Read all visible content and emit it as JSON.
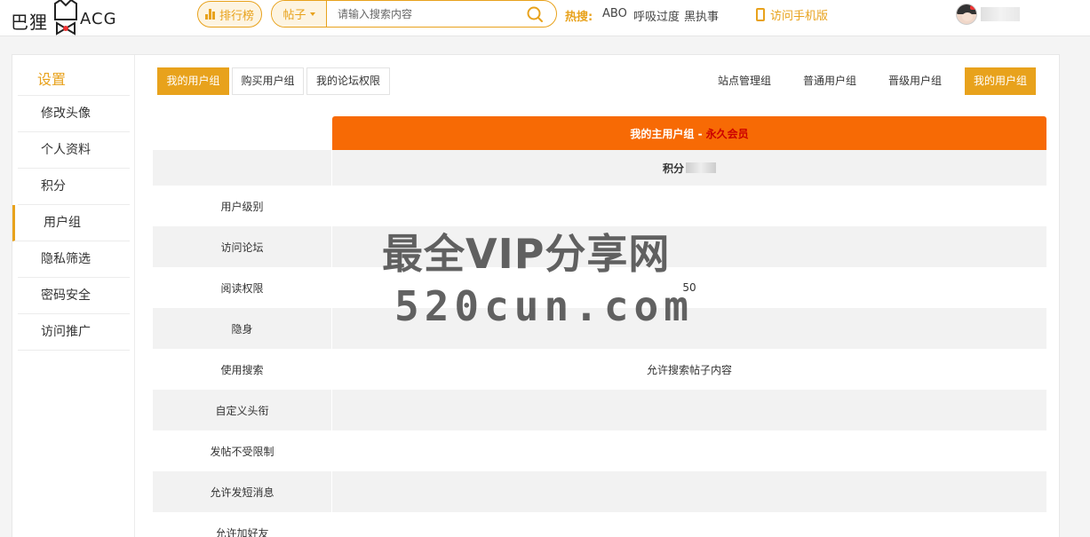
{
  "header": {
    "logo_left": "巴狸",
    "logo_right": "ACG",
    "rank_label": "排行榜",
    "search_type": "帖子",
    "search_placeholder": "请输入搜索内容",
    "hot_label": "热搜:",
    "hot_items": [
      "ABO",
      "呼吸过度",
      "黑执事"
    ],
    "mobile_label": "访问手机版"
  },
  "sidebar": {
    "title": "设置",
    "items": [
      {
        "label": "修改头像"
      },
      {
        "label": "个人资料"
      },
      {
        "label": "积分"
      },
      {
        "label": "用户组",
        "active": true
      },
      {
        "label": "隐私筛选"
      },
      {
        "label": "密码安全"
      },
      {
        "label": "访问推广"
      }
    ]
  },
  "tabs": {
    "left": [
      "我的用户组",
      "购买用户组",
      "我的论坛权限"
    ],
    "right": [
      "站点管理组",
      "普通用户组",
      "晋级用户组",
      "我的用户组"
    ]
  },
  "usergroup": {
    "header_prefix": "我的主用户组 - ",
    "group_name": "永久会员",
    "score_label": "积分"
  },
  "rows": [
    {
      "label": "用户级别",
      "value": ""
    },
    {
      "label": "访问论坛",
      "value": ""
    },
    {
      "label": "阅读权限",
      "value": "50"
    },
    {
      "label": "隐身",
      "value": ""
    },
    {
      "label": "使用搜索",
      "value": "允许搜索帖子内容"
    },
    {
      "label": "自定义头衔",
      "value": ""
    },
    {
      "label": "发帖不受限制",
      "value": ""
    },
    {
      "label": "允许发短消息",
      "value": ""
    },
    {
      "label": "允许加好友",
      "value": ""
    }
  ],
  "watermark": {
    "line1": "最全VIP分享网",
    "line2": "520cun.com"
  },
  "colors": {
    "accent": "#e8a21c",
    "header_orange": "#f76a05",
    "vip_red": "#cc0000"
  }
}
